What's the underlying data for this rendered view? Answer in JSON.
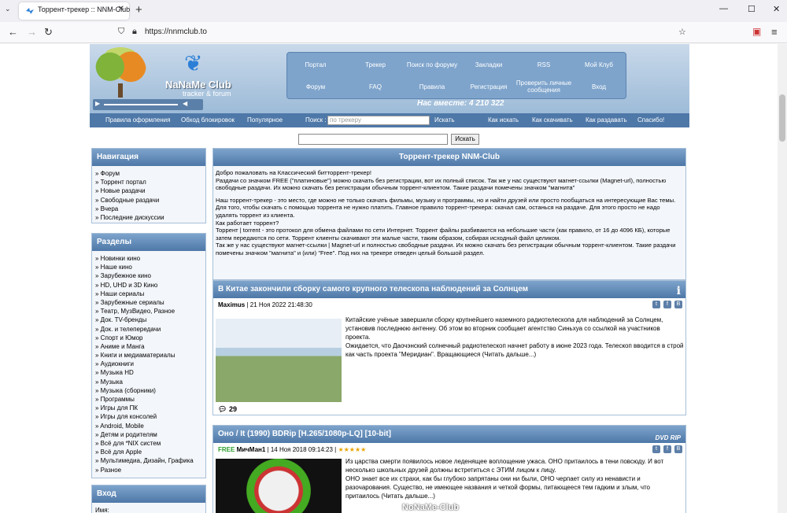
{
  "browser": {
    "tab_title": "Торрент-трекер :: NNM-Club",
    "url": "https://nnmclub.to"
  },
  "site": {
    "logo_title": "NaNaMe Club",
    "logo_sub": "tracker & forum",
    "menu": [
      "Портал",
      "Трекер",
      "Поиск по форуму",
      "Закладки",
      "RSS",
      "Мой Клуб",
      "Форум",
      "FAQ",
      "Правила",
      "Регистрация",
      "Проверить личные сообщения",
      "Вход"
    ],
    "online": "Нас вместе: 4 210 322",
    "toolbar": {
      "rules": "Правила оформления",
      "bypass": "Обход блокировок",
      "popular": "Популярное",
      "search_label": "Поиск :",
      "search_placeholder": "по трекеру",
      "search_btn": "Искать",
      "how_search": "Как искать",
      "how_download": "Как скачивать",
      "how_seed": "Как раздавать",
      "thanks": "Спасибо!"
    },
    "main_search_btn": "Искать"
  },
  "sidebar": {
    "nav_title": "Навигация",
    "nav_items": [
      "» Форум",
      "» Торрент портал",
      "» Новые раздачи",
      "» Свободные раздачи",
      "» Вчера",
      "» Последние дискуссии"
    ],
    "sections_title": "Разделы",
    "sections": [
      "» Новинки кино",
      "» Наше кино",
      "» Зарубежное кино",
      "» HD, UHD и 3D Кино",
      "» Наши сериалы",
      "» Зарубежные сериалы",
      "» Театр, МузВидео, Разное",
      "» Док. TV-бренды",
      "» Док. и телепередачи",
      "» Спорт и Юмор",
      "» Аниме и Манга",
      "» Книги и медиаматериалы",
      "» Аудиокниги",
      "» Музыка HD",
      "» Музыка",
      "» Музыка (сборники)",
      "» Программы",
      "» Игры для ПК",
      "» Игры для консолей",
      "» Android, Mobile",
      "» Детям и родителям",
      "» Всё для *NIX систем",
      "» Всё для Apple",
      "» Мультимедиа, Дизайн, Графика",
      "» Разное"
    ],
    "login_title": "Вход",
    "login_name": "Имя:"
  },
  "welcome": {
    "title": "Торрент-трекер NNM-Club",
    "p1": "Добро пожаловать на Классический битторрент-трекер!",
    "p2": "Раздачи со значком FREE (\"платиновые\") можно скачать без регистрации, вот их полный список. Так же у нас существуют магнет-ссылки (Magnet-url), полностью свободные раздачи. Их можно скачать без регистрации обычным торрент-клиентом. Такие раздачи помечены значком \"магнита\"",
    "p3": "Наш торрент-трекер - это место, где можно не только скачать фильмы, музыку и программы, но и найти друзей или просто пообщаться на интересующие Вас темы. Для того, чтобы скачать с помощью торрента не нужно платить. Главное правило торрент-трекера: скачал сам, останься на раздаче. Для этого просто не надо удалять торрент из клиента.",
    "p4": "Как работает торрент?",
    "p5": "Торрент | torrent - это протокол для обмена файлами по сети Интернет. Торрент файлы разбиваются на небольшие части (как правило, от 16 до 4096 КБ), которые затем передаются по сети. Торрент клиенты скачивают эти малые части, таким образом, собирая исходный файл целиком.",
    "p6": "Так же у нас существуют магнет-ссылки | Magnet-url и полностью свободные раздачи. Их можно скачать без регистрации обычным торрент-клиентом. Такие раздачи помечены значком \"магнита\" и (или) \"Free\". Под них на трекере отведен целый большой раздел."
  },
  "news1": {
    "title": "В Китае закончили сборку самого крупного телескопа наблюдений за Солнцем",
    "author": "Maximus",
    "date": "| 21 Ноя 2022 21:48:30",
    "body": "Китайские учёные завершили сборку крупнейшего наземного радиотелескопа для наблюдений за Солнцем, установив последнюю антенну. Об этом во вторник сообщает агентство Синьхуа со ссылкой на участников проекта.",
    "body2": "Ожидается, что Даочэнский солнечный радиотелескоп начнет работу в июне 2023 года. Телескоп вводится в строй как часть проекта \"Меридиан\". Вращающиеся (Читать дальше...)",
    "comments": "29"
  },
  "news2": {
    "title": "Оно / It (1990) BDRip [H.265/1080p-LQ] [10-bit]",
    "free": "FREE",
    "author": "МичМан1",
    "date": "| 14 Ноя 2018 09:14:23 |",
    "stars": "★★★★★",
    "body": "Из царства смерти появилось новое леденящее воплощение ужаса. ОНО притаилось в тени повсюду. И вот несколько школьных друзей должны встретиться с ЭТИМ лицом к лицу.",
    "body2": "ОНО знает все их страхи, как бы глубоко запрятаны они ни были, ОНО черпает силу из ненависти и разочарования. Существо, не имеющее названия и четкой формы, питающееся тем гадким и злым, что притаилось (Читать дальше...)",
    "watermark": "NoNaMe-Club",
    "dvd": "DVD RIP"
  }
}
